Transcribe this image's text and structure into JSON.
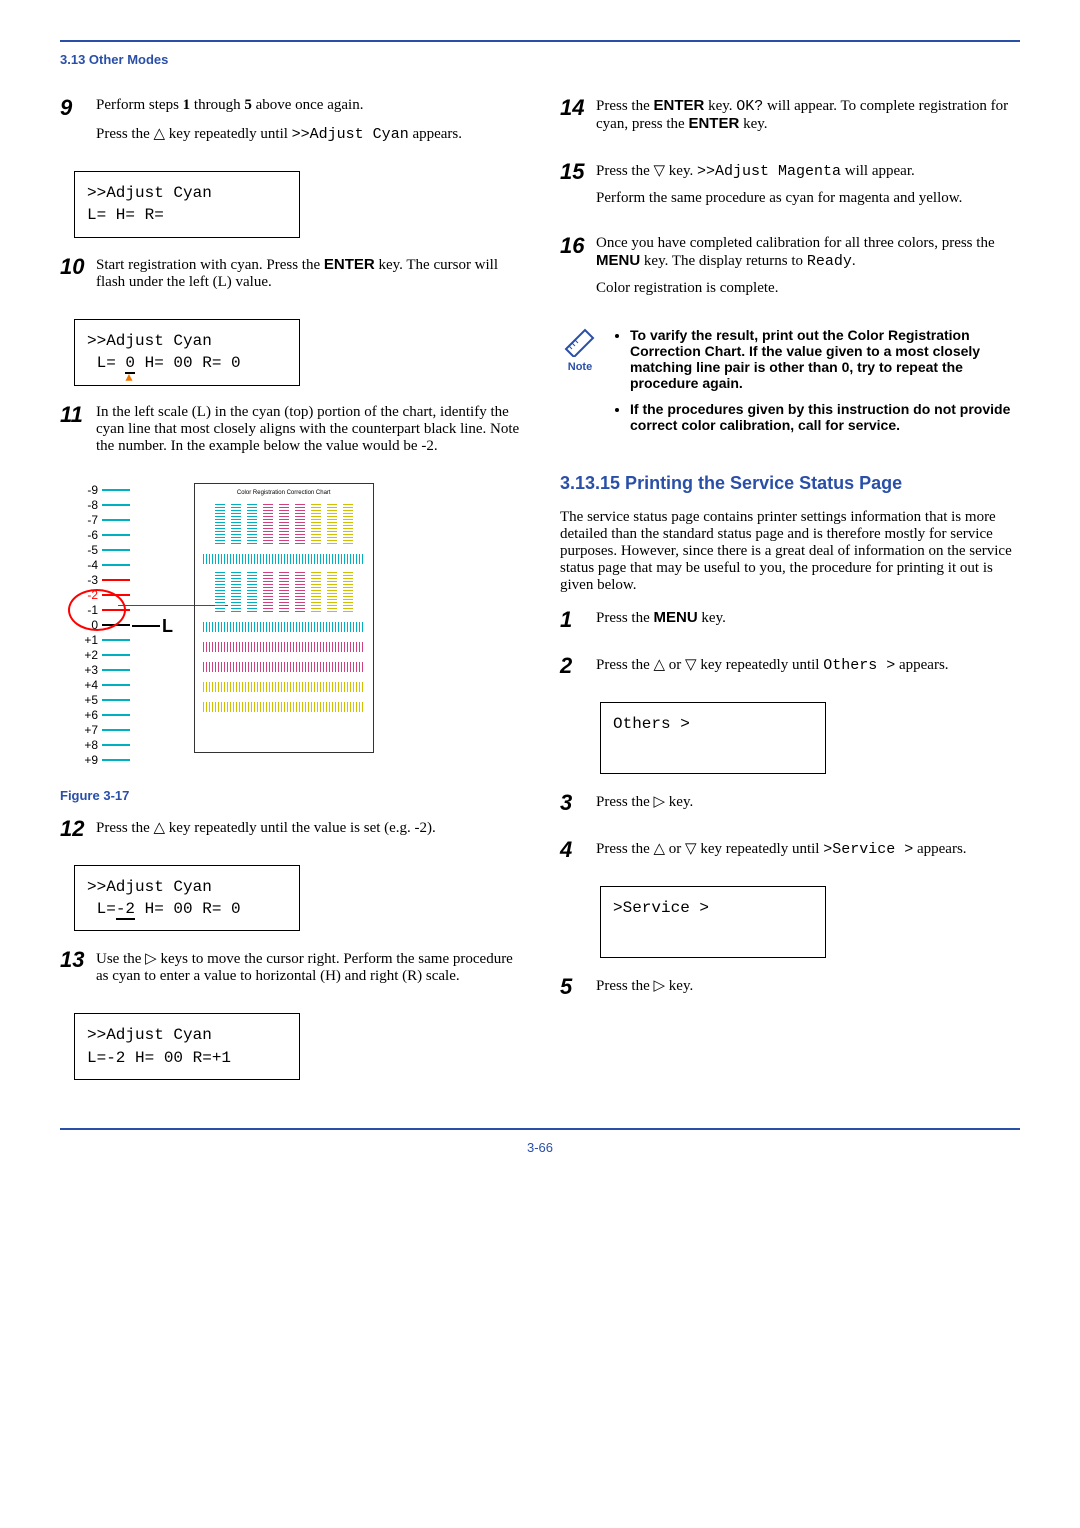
{
  "header": {
    "section": "3.13 Other Modes"
  },
  "left": {
    "step9": {
      "num": "9",
      "p1a": "Perform steps ",
      "p1b": "1",
      "p1c": " through ",
      "p1d": "5",
      "p1e": " above once again.",
      "p2a": "Press the ",
      "p2b": " key repeatedly until ",
      "p2c": ">>Adjust Cyan",
      "p2d": " appears."
    },
    "display1": {
      "line1": ">>Adjust Cyan",
      "line2": " L=   H=    R="
    },
    "step10": {
      "num": "10",
      "p1a": "Start registration with cyan. Press the ",
      "p1b": "ENTER",
      "p1c": " key. The cursor will flash under the left (L) value."
    },
    "display2": {
      "line1": ">>Adjust Cyan",
      "line2": " L= 0 H= 00 R= 0"
    },
    "step11": {
      "num": "11",
      "p1": "In the left scale (L) in the cyan (top) portion of the chart, identify the cyan line that most closely aligns with the counterpart black line. Note the number. In the example below the value would be -2."
    },
    "chart": {
      "scale": [
        "-9",
        "-8",
        "-7",
        "-6",
        "-5",
        "-4",
        "-3",
        "-2",
        "-1",
        "0",
        "+1",
        "+2",
        "+3",
        "+4",
        "+5",
        "+6",
        "+7",
        "+8",
        "+9"
      ],
      "L": "L",
      "tiny_title": "Color Registration Correction Chart"
    },
    "figure_label": "Figure 3-17",
    "step12": {
      "num": "12",
      "p1a": "Press the ",
      "p1b": " key repeatedly until the value is set (e.g. -2)."
    },
    "display3": {
      "line1": ">>Adjust Cyan",
      "line2": " L=-2 H= 00 R= 0"
    },
    "step13": {
      "num": "13",
      "p1a": "Use the ",
      "p1b": " keys to move the cursor right. Perform the same procedure as cyan to enter a value to horizontal (H) and right (R) scale."
    },
    "display4": {
      "line1": ">>Adjust Cyan",
      "line2": " L=-2 H= 00 R=+1"
    }
  },
  "right": {
    "step14": {
      "num": "14",
      "p1a": "Press the ",
      "p1b": "ENTER",
      "p1c": " key. ",
      "p1d": "OK?",
      "p1e": " will appear. To complete registration for cyan, press the ",
      "p1f": "ENTER",
      "p1g": " key."
    },
    "step15": {
      "num": "15",
      "p1a": "Press the ",
      "p1b": " key. ",
      "p1c": ">>Adjust Magenta",
      "p1d": " will appear.",
      "p2": "Perform the same procedure as cyan  for magenta and yellow."
    },
    "step16": {
      "num": "16",
      "p1a": "Once you have completed calibration for all three colors, press the ",
      "p1b": "MENU",
      "p1c": " key. The display returns to ",
      "p1d": "Ready",
      "p1e": ".",
      "p2": "Color registration is complete."
    },
    "note": {
      "label": "Note",
      "bullet1": "To varify the result, print out the Color Registration Correction Chart. If the value given to a most closely matching line pair is other than 0, try to repeat the procedure again.",
      "bullet2": "If the procedures given by this instruction do not provide correct color calibration, call for service."
    },
    "subsection": {
      "title": "3.13.15  Printing the Service Status Page",
      "intro": "The service status page contains printer settings information that is more detailed than the standard status page and is therefore mostly for service purposes. However, since there is a great deal of information on the service status page that may be useful to you, the procedure for printing it out is given below."
    },
    "step1": {
      "num": "1",
      "p1a": "Press the ",
      "p1b": "MENU",
      "p1c": " key."
    },
    "step2": {
      "num": "2",
      "p1a": "Press the ",
      "p1b": " or ",
      "p1c": " key repeatedly until ",
      "p1d": "Others  >",
      "p1e": " appears."
    },
    "display5": {
      "line1": "Others          >"
    },
    "step3": {
      "num": "3",
      "p1a": "Press the ",
      "p1b": " key."
    },
    "step4": {
      "num": "4",
      "p1a": "Press the ",
      "p1b": " or ",
      "p1c": " key repeatedly until ",
      "p1d": ">Service  >",
      "p1e": " appears."
    },
    "display6": {
      "line1": ">Service        >"
    },
    "step5": {
      "num": "5",
      "p1a": "Press the ",
      "p1b": " key."
    }
  },
  "footer": {
    "page": "3-66"
  },
  "chart_data": {
    "type": "table",
    "title": "Color Registration Correction Chart – L scale ticks",
    "scale_values": [
      -9,
      -8,
      -7,
      -6,
      -5,
      -4,
      -3,
      -2,
      -1,
      0,
      1,
      2,
      3,
      4,
      5,
      6,
      7,
      8,
      9
    ],
    "highlighted_value": -2,
    "label": "L"
  }
}
